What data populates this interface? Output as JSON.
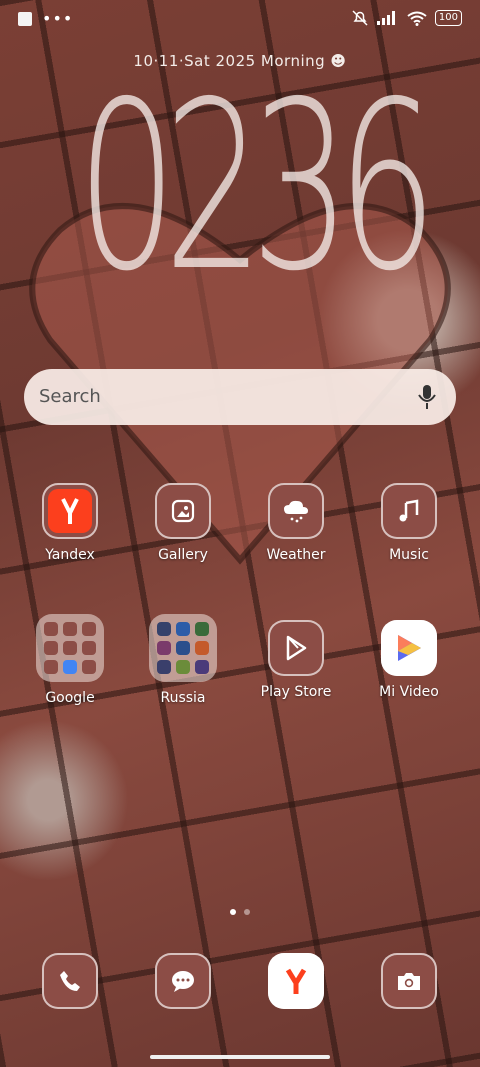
{
  "status": {
    "battery": "100",
    "icons": [
      "square-icon",
      "more-dots-icon",
      "mute-icon",
      "signal-icon",
      "wifi-icon",
      "battery-icon"
    ]
  },
  "lockscreen": {
    "date": "10·11·Sat  2025  Morning ☻",
    "time": "0236"
  },
  "search": {
    "placeholder": "Search"
  },
  "apps_row1": [
    {
      "label": "Yandex",
      "icon": "yandex-icon"
    },
    {
      "label": "Gallery",
      "icon": "gallery-icon"
    },
    {
      "label": "Weather",
      "icon": "weather-icon"
    },
    {
      "label": "Music",
      "icon": "music-icon"
    }
  ],
  "apps_row2": [
    {
      "label": "Google",
      "icon": "folder-icon"
    },
    {
      "label": "Russia",
      "icon": "folder-icon"
    },
    {
      "label": "Play Store",
      "icon": "play-store-icon"
    },
    {
      "label": "Mi Video",
      "icon": "mi-video-icon"
    }
  ],
  "dock": [
    "phone-icon",
    "messages-icon",
    "yandex-browser-icon",
    "camera-icon"
  ],
  "page_indicator": {
    "pages": 2,
    "current": 1
  },
  "colors": {
    "icon_bg": "#8c4d46",
    "search_bg": "#faeee8",
    "yandex_red": "#fc3f1d"
  }
}
